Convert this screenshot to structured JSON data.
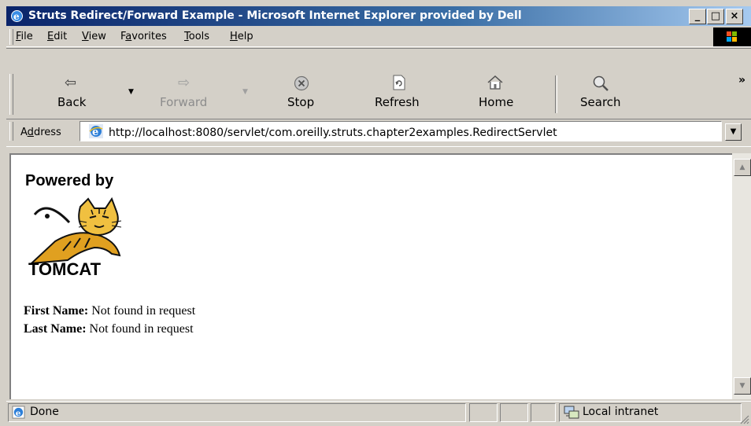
{
  "window": {
    "title": "Struts Redirect/Forward Example - Microsoft Internet Explorer provided by Dell",
    "minimize": "_",
    "maximize": "□",
    "close": "×"
  },
  "menu": {
    "items": [
      {
        "key": "F",
        "rest": "ile"
      },
      {
        "key": "E",
        "rest": "dit"
      },
      {
        "key": "V",
        "rest": "iew"
      },
      {
        "pre": "F",
        "key": "a",
        "rest": "vorites"
      },
      {
        "key": "T",
        "rest": "ools"
      },
      {
        "key": "H",
        "rest": "elp"
      }
    ]
  },
  "toolbar": {
    "back": "Back",
    "forward": "Forward",
    "stop": "Stop",
    "refresh": "Refresh",
    "home": "Home",
    "search": "Search",
    "chevron": "»"
  },
  "address": {
    "label_pre": "A",
    "label_key": "d",
    "label_rest": "dress",
    "url": "http://localhost:8080/servlet/com.oreilly.struts.chapter2examples.RedirectServlet"
  },
  "content": {
    "powered_by": "Powered by",
    "tomcat": "TOMCAT",
    "first_label": "First Name:",
    "first_value": " Not found in request",
    "last_label": "Last Name:",
    "last_value": " Not found in request"
  },
  "status": {
    "text": "Done",
    "zone": "Local intranet"
  },
  "colors": {
    "title_start": "#0a246a",
    "title_end": "#a6caf0",
    "chrome": "#d4d0c8"
  }
}
